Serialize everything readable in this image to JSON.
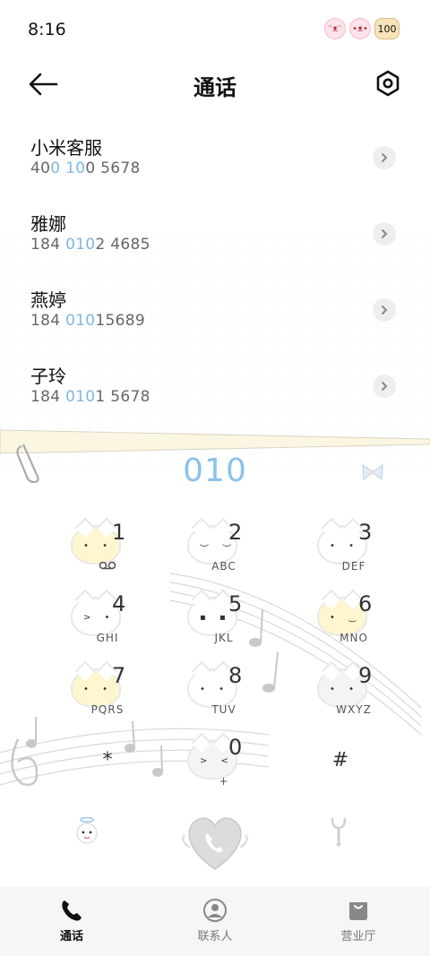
{
  "status": {
    "time": "8:16",
    "battery": "100"
  },
  "header": {
    "title": "通话"
  },
  "contacts": [
    {
      "name": "小米客服",
      "num_pre": "40",
      "num_hl1": "0",
      "num_mid": " ",
      "num_hl2": "10",
      "num_post": "0 5678"
    },
    {
      "name": "雅娜",
      "num_pre": "184 ",
      "num_hl1": "010",
      "num_mid": "",
      "num_hl2": "",
      "num_post": "2 4685"
    },
    {
      "name": "燕婷",
      "num_pre": "184 ",
      "num_hl1": "010",
      "num_mid": "",
      "num_hl2": "",
      "num_post": "15689"
    },
    {
      "name": "子玲",
      "num_pre": "184 ",
      "num_hl1": "010",
      "num_mid": "",
      "num_hl2": "",
      "num_post": "1 5678"
    }
  ],
  "dialer": {
    "input": "010"
  },
  "keypad": [
    {
      "digit": "1",
      "letters": ""
    },
    {
      "digit": "2",
      "letters": "ABC"
    },
    {
      "digit": "3",
      "letters": "DEF"
    },
    {
      "digit": "4",
      "letters": "GHI"
    },
    {
      "digit": "5",
      "letters": "JKL"
    },
    {
      "digit": "6",
      "letters": "MNO"
    },
    {
      "digit": "7",
      "letters": "PQRS"
    },
    {
      "digit": "8",
      "letters": "TUV"
    },
    {
      "digit": "9",
      "letters": "WXYZ"
    },
    {
      "digit": "*",
      "letters": ""
    },
    {
      "digit": "0",
      "letters": "+"
    },
    {
      "digit": "#",
      "letters": ""
    }
  ],
  "tabs": [
    {
      "label": "通话",
      "active": true
    },
    {
      "label": "联系人",
      "active": false
    },
    {
      "label": "营业厅",
      "active": false
    }
  ],
  "colors": {
    "accent": "#8cc1ec",
    "highlight": "#7fb6e6"
  }
}
